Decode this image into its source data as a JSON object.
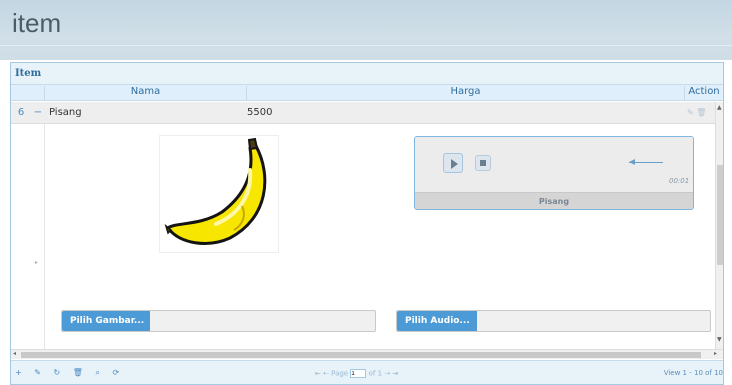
{
  "window": {
    "title": "item"
  },
  "grid": {
    "caption": "Item",
    "columns": {
      "nama": "Nama",
      "harga": "Harga",
      "action": "Action"
    },
    "row": {
      "number": "6",
      "toggle": "−",
      "nama": "Pisang",
      "harga": "5500",
      "action_icons": "✎ 🗑"
    },
    "detail": {
      "image_alt": "banana",
      "audio": {
        "title": "Pisang",
        "time": "00:01"
      },
      "pick_image_label": "Pilih Gambar...",
      "pick_audio_label": "Pilih Audio..."
    },
    "pager": {
      "tools": "+ ✎ ↻ 🗑 ⌕ ⟳",
      "nav_prefix": "⇤ ⇠ Page",
      "page_value": "1",
      "nav_suffix": "of 1 ⇢ ⇥",
      "view": "View 1 - 10 of 10"
    }
  },
  "colors": {
    "header_bg": "#c3d6e2",
    "accent": "#4d9bd6",
    "grid_border": "#a6c9e2"
  }
}
